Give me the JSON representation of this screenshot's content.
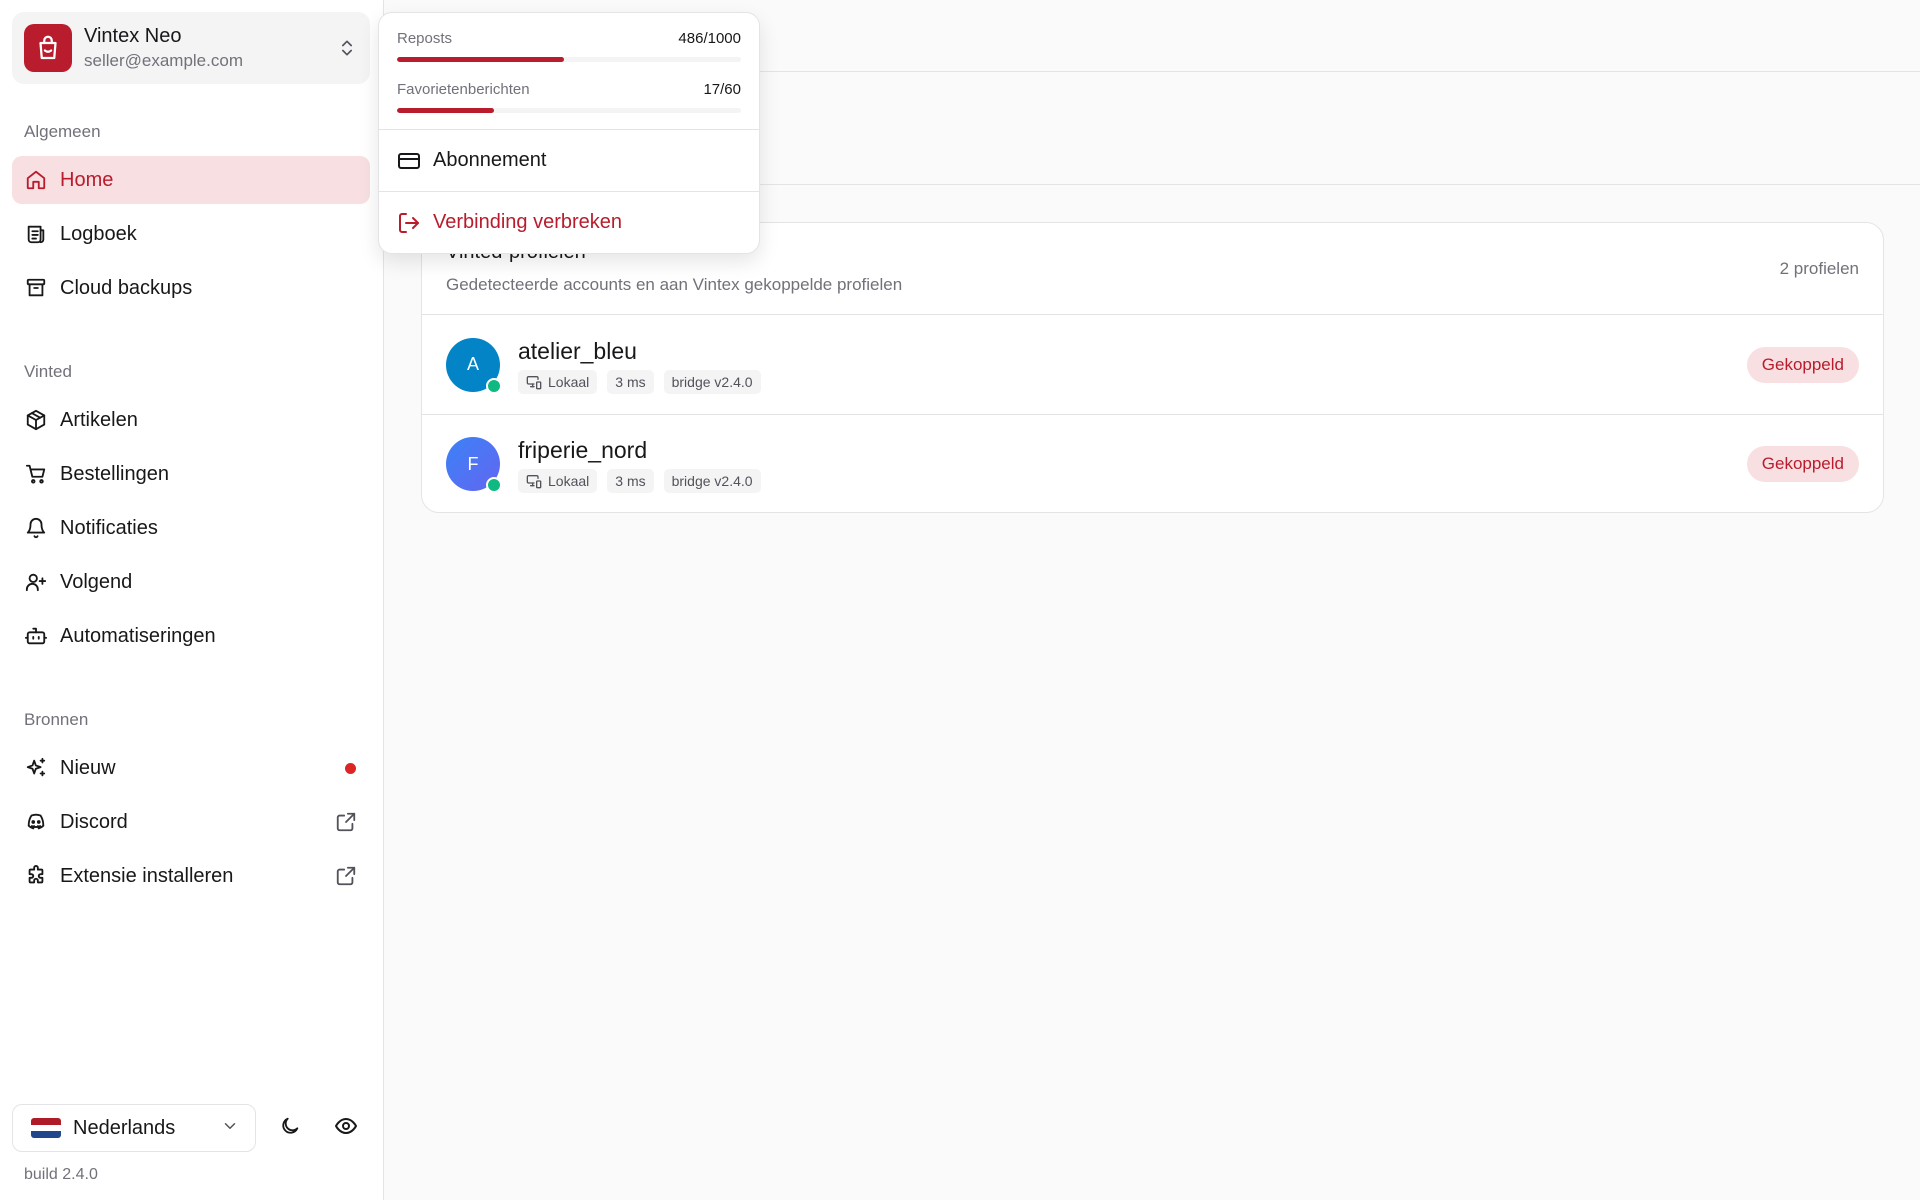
{
  "account": {
    "name": "Vintex Neo",
    "email": "seller@example.com"
  },
  "sidebar": {
    "sections": {
      "general": "Algemeen",
      "vinted": "Vinted",
      "sources": "Bronnen"
    },
    "items": [
      {
        "label": "Home",
        "icon": "home-icon",
        "active": true
      },
      {
        "label": "Logboek",
        "icon": "logbook-icon"
      },
      {
        "label": "Cloud backups",
        "icon": "archive-icon"
      },
      {
        "label": "Artikelen",
        "icon": "package-icon"
      },
      {
        "label": "Bestellingen",
        "icon": "cart-icon"
      },
      {
        "label": "Notificaties",
        "icon": "bell-icon"
      },
      {
        "label": "Volgend",
        "icon": "user-plus-icon"
      },
      {
        "label": "Automatiseringen",
        "icon": "bot-icon"
      },
      {
        "label": "Nieuw",
        "icon": "sparkles-icon",
        "badge_dot": true
      },
      {
        "label": "Discord",
        "icon": "discord-icon",
        "external": true
      },
      {
        "label": "Extensie installeren",
        "icon": "puzzle-icon",
        "external": true
      }
    ],
    "language": "Nederlands",
    "build": "build 2.4.0"
  },
  "dropdown": {
    "usage": [
      {
        "label": "Reposts",
        "value": "486/1000",
        "fraction": 0.486
      },
      {
        "label": "Favorietenberichten",
        "value": "17/60",
        "fraction": 0.283
      }
    ],
    "subscription_label": "Abonnement",
    "disconnect_label": "Verbinding verbreken"
  },
  "profiles_card": {
    "title": "Vinted-profielen",
    "subtitle": "Gedetecteerde accounts en aan Vintex gekoppelde profielen",
    "count": "2 profielen",
    "profiles": [
      {
        "initial": "A",
        "name": "atelier_bleu",
        "chips": [
          "Lokaal",
          "3 ms",
          "bridge v2.4.0"
        ],
        "status": "Gekoppeld",
        "avatar_color": "#0284c7"
      },
      {
        "initial": "F",
        "name": "friperie_nord",
        "chips": [
          "Lokaal",
          "3 ms",
          "bridge v2.4.0"
        ],
        "status": "Gekoppeld",
        "avatar_color": "#4f46e5"
      }
    ]
  },
  "colors": {
    "accent": "#b91c2c",
    "accent_soft": "#f8dfe2",
    "online": "#10b981"
  }
}
